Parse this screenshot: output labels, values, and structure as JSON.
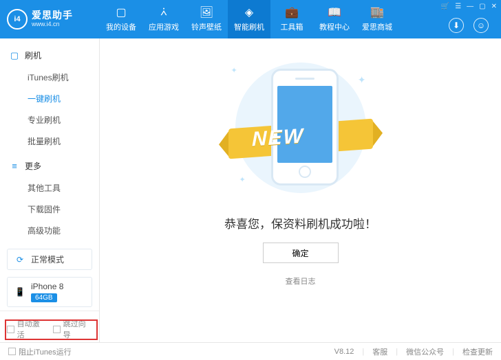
{
  "header": {
    "logo_badge": "i4",
    "brand": "爱思助手",
    "url": "www.i4.cn",
    "nav": [
      {
        "label": "我的设备",
        "icon": "▢"
      },
      {
        "label": "应用游戏",
        "icon": "⩑"
      },
      {
        "label": "铃声壁纸",
        "icon": "🖼"
      },
      {
        "label": "智能刷机",
        "icon": "◈"
      },
      {
        "label": "工具箱",
        "icon": "💼"
      },
      {
        "label": "教程中心",
        "icon": "📖"
      },
      {
        "label": "爱思商城",
        "icon": "🏬"
      }
    ],
    "download_icon": "⬇",
    "user_icon": "☺"
  },
  "sidebar": {
    "group1": {
      "title": "刷机",
      "icon": "▢"
    },
    "items1": [
      {
        "label": "iTunes刷机"
      },
      {
        "label": "一键刷机"
      },
      {
        "label": "专业刷机"
      },
      {
        "label": "批量刷机"
      }
    ],
    "group2": {
      "title": "更多",
      "icon": "≡"
    },
    "items2": [
      {
        "label": "其他工具"
      },
      {
        "label": "下载固件"
      },
      {
        "label": "高级功能"
      }
    ],
    "mode": {
      "label": "正常模式",
      "icon": "⟳"
    },
    "device": {
      "name": "iPhone 8",
      "storage": "64GB",
      "icon": "📱"
    },
    "opt_auto_activate": "自动激活",
    "opt_skip_guide": "跳过向导"
  },
  "main": {
    "new_label": "NEW",
    "success_msg": "恭喜您，保资料刷机成功啦！",
    "ok_btn": "确定",
    "view_log": "查看日志"
  },
  "status": {
    "block_itunes": "阻止iTunes运行",
    "version": "V8.12",
    "support": "客服",
    "wechat": "微信公众号",
    "check_update": "检查更新"
  }
}
